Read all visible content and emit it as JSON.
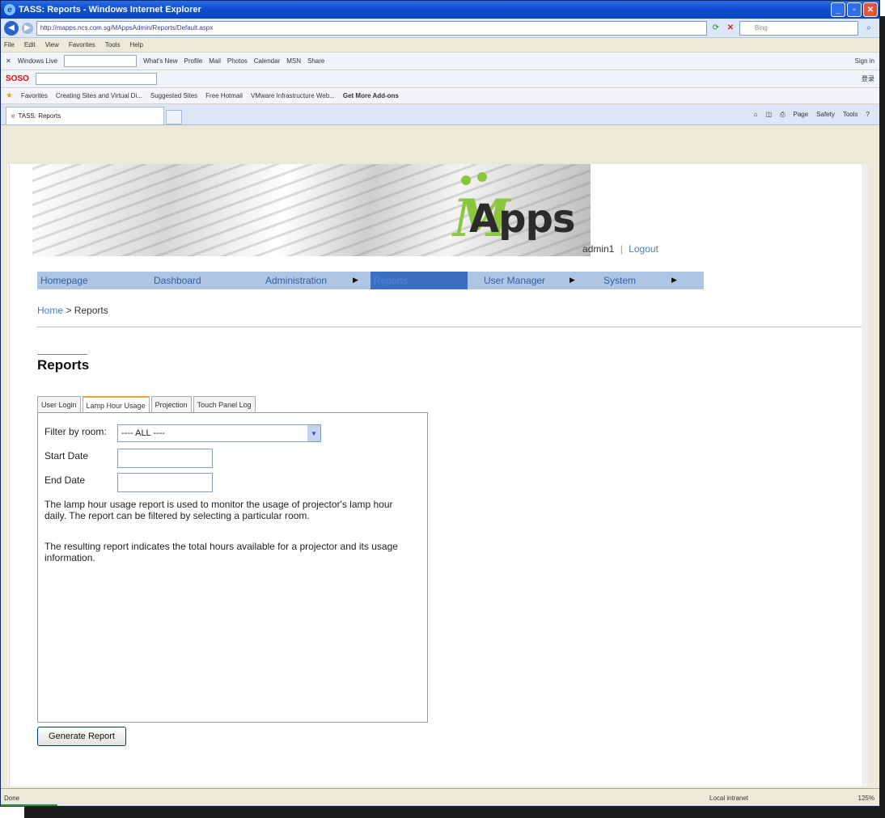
{
  "window": {
    "title": "TASS: Reports - Windows Internet Explorer"
  },
  "browser": {
    "url": "http://mapps.ncs.com.sg/MAppsAdmin/Reports/Default.aspx",
    "search_placeholder": "Bing",
    "menu": [
      "File",
      "Edit",
      "View",
      "Favorites",
      "Tools",
      "Help"
    ],
    "toolbar1": {
      "windows_live": "Windows Live",
      "items": [
        "What's New",
        "Profile",
        "Mail",
        "Photos",
        "Calendar",
        "MSN",
        "Share"
      ],
      "sign_in": "Sign in"
    },
    "toolbar2": {
      "brand": "SOSO",
      "right_label": "登录"
    },
    "favorites": {
      "label": "Favorites",
      "items": [
        "Creating Sites and Virtual Di...",
        "Suggested Sites",
        "Free Hotmail",
        "VMware Infrastructure Web...",
        "Get More Add-ons"
      ]
    },
    "tab_title": "TASS: Reports",
    "command_bar": [
      "Page",
      "Safety",
      "Tools"
    ]
  },
  "header": {
    "logo_text": "Apps",
    "user": "admin1",
    "separator": "|",
    "logout": "Logout"
  },
  "nav": {
    "items": [
      {
        "label": "Homepage",
        "submenu": false,
        "active": false
      },
      {
        "label": "Dashboard",
        "submenu": false,
        "active": false
      },
      {
        "label": "Administration",
        "submenu": true,
        "active": false
      },
      {
        "label": "Reports",
        "submenu": false,
        "active": true
      },
      {
        "label": "User Manager",
        "submenu": true,
        "active": false
      },
      {
        "label": "System",
        "submenu": true,
        "active": false
      }
    ],
    "active_color": "#3a6fc4",
    "bar_color": "#aec5e4"
  },
  "breadcrumb": {
    "home": "Home",
    "separator": ">",
    "current": "Reports"
  },
  "page": {
    "title": "Reports",
    "tabs": [
      "User Login",
      "Lamp Hour Usage",
      "Projection",
      "Touch Panel Log"
    ],
    "active_tab": "Lamp Hour Usage",
    "filter_label": "Filter by room:",
    "room_selected": "---- ALL ----",
    "start_date_label": "Start Date",
    "end_date_label": "End Date",
    "start_date_value": "",
    "end_date_value": "",
    "description_1": "The lamp hour usage report is used to monitor the usage of projector's lamp hour daily. The report can be filtered by selecting a particular room.",
    "description_2": "The resulting report indicates the total hours available for a projector and its usage information.",
    "generate_button": "Generate Report"
  },
  "status": {
    "done": "Done",
    "zone": "Local intranet",
    "zoom": "125%"
  },
  "colors": {
    "accent_green": "#8cc63f",
    "link_blue": "#4a7fc1",
    "tab_highlight": "#e6a23c"
  }
}
